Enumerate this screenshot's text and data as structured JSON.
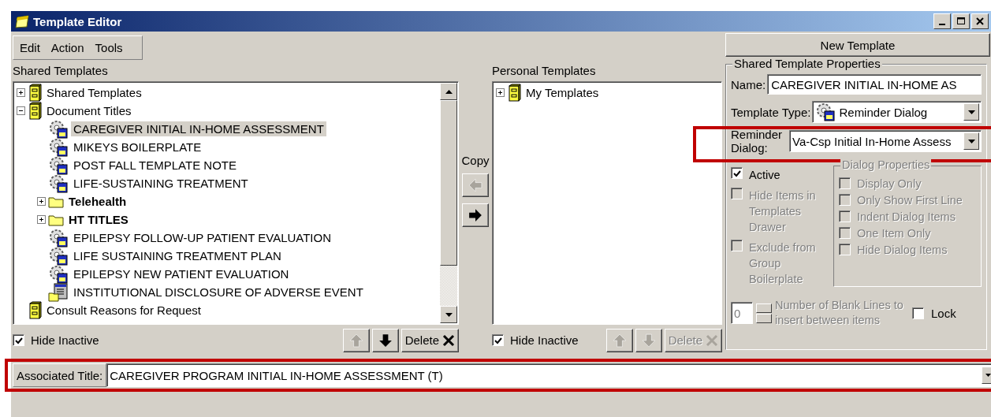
{
  "window": {
    "title": "Template Editor"
  },
  "menu": [
    {
      "label": "Edit"
    },
    {
      "label": "Action"
    },
    {
      "label": "Tools"
    }
  ],
  "shared_panel": {
    "label": "Shared Templates",
    "tree": [
      {
        "label": "Shared Templates",
        "kind": "cabinet",
        "expanded": false,
        "selected": false
      },
      {
        "label": "Document Titles",
        "kind": "cabinet",
        "expanded": true,
        "selected": false,
        "children": [
          {
            "label": "CAREGIVER INITIAL IN-HOME ASSESSMENT",
            "kind": "reminder",
            "selected": true
          },
          {
            "label": "MIKEYS BOILERPLATE",
            "kind": "reminder",
            "selected": false
          },
          {
            "label": "POST FALL TEMPLATE NOTE",
            "kind": "reminder",
            "selected": false
          },
          {
            "label": "LIFE-SUSTAINING TREATMENT",
            "kind": "reminder",
            "selected": false
          },
          {
            "label": "Telehealth",
            "kind": "folder",
            "expanded": false,
            "selected": false
          },
          {
            "label": "HT TITLES",
            "kind": "folder",
            "expanded": false,
            "selected": false
          },
          {
            "label": "EPILEPSY FOLLOW-UP PATIENT EVALUATION",
            "kind": "reminder",
            "selected": false
          },
          {
            "label": "LIFE SUSTAINING TREATMENT PLAN",
            "kind": "reminder",
            "selected": false
          },
          {
            "label": "EPILEPSY NEW PATIENT EVALUATION",
            "kind": "reminder",
            "selected": false
          },
          {
            "label": "INSTITUTIONAL DISCLOSURE OF ADVERSE EVENT",
            "kind": "form",
            "selected": false
          }
        ]
      },
      {
        "label": "Consult Reasons for Request",
        "kind": "cabinet",
        "selected": false
      }
    ],
    "hide_inactive": {
      "label": "Hide Inactive",
      "checked": true
    },
    "buttons": [
      {
        "kind": "up",
        "disabled": true
      },
      {
        "kind": "down",
        "disabled": false
      },
      {
        "kind": "delete",
        "label": "Delete",
        "disabled": false
      }
    ]
  },
  "copy": {
    "label": "Copy",
    "buttons": [
      {
        "kind": "left",
        "disabled": true
      },
      {
        "kind": "right",
        "disabled": false
      }
    ]
  },
  "personal_panel": {
    "label": "Personal Templates",
    "tree": [
      {
        "label": "My Templates",
        "kind": "cabinet",
        "expanded": false,
        "selected": false
      }
    ],
    "hide_inactive": {
      "label": "Hide Inactive",
      "checked": true
    },
    "buttons": [
      {
        "kind": "up",
        "disabled": true
      },
      {
        "kind": "down",
        "disabled": true
      },
      {
        "kind": "delete",
        "label": "Delete",
        "disabled": true
      }
    ]
  },
  "new_template_button": {
    "label": "New Template"
  },
  "properties": {
    "title": "Shared Template Properties",
    "name": {
      "label": "Name:",
      "value": "CAREGIVER INITIAL IN-HOME AS"
    },
    "template_type": {
      "label": "Template Type:",
      "value": "Reminder Dialog"
    },
    "reminder_dialog": {
      "label": "Reminder Dialog:",
      "value": "Va-Csp Initial In-Home Assess",
      "highlighted": true
    },
    "options": [
      {
        "label": "Active",
        "checked": true,
        "disabled": false
      },
      {
        "label": "Hide Items in Templates Drawer",
        "checked": false,
        "disabled": true
      },
      {
        "label": "Exclude from Group Boilerplate",
        "checked": false,
        "disabled": true
      }
    ],
    "dialog_properties": {
      "title": "Dialog Properties",
      "options": [
        {
          "label": "Display Only",
          "checked": false,
          "disabled": true
        },
        {
          "label": "Only Show First Line",
          "checked": false,
          "disabled": true
        },
        {
          "label": "Indent Dialog Items",
          "checked": false,
          "disabled": true
        },
        {
          "label": "One Item Only",
          "checked": false,
          "disabled": true
        },
        {
          "label": "Hide Dialog Items",
          "checked": false,
          "disabled": true
        }
      ]
    },
    "blank_lines": {
      "value": "0",
      "label": "Number of Blank Lines to insert between items",
      "disabled": true
    },
    "lock": {
      "label": "Lock",
      "checked": false
    }
  },
  "associated_title": {
    "label": "Associated Title:",
    "value": "CAREGIVER PROGRAM INITIAL IN-HOME ASSESSMENT (T)",
    "highlighted": true
  }
}
